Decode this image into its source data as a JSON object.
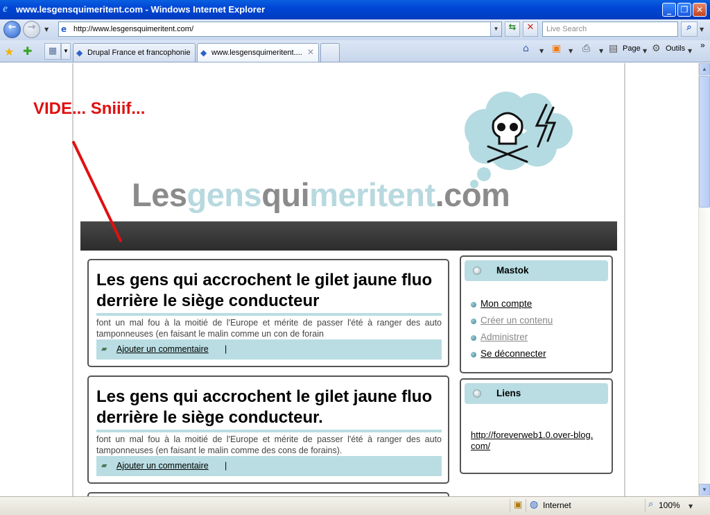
{
  "window": {
    "title": "www.lesgensquimeritent.com - Windows Internet Explorer",
    "minimize": "_",
    "maximize": "❐",
    "close": "✕"
  },
  "nav": {
    "back_icon": "back-arrow-icon",
    "forward_icon": "forward-arrow-icon",
    "address_url": "http://www.lesgensquimeritent.com/",
    "search_placeholder": "Live Search"
  },
  "tabs": [
    {
      "label": "Drupal France et francophonie",
      "active": false
    },
    {
      "label": "www.lesgensquimeritent....",
      "active": true
    }
  ],
  "commandbar": {
    "page_label": "Page",
    "tools_label": "Outils"
  },
  "page": {
    "annotation": "VIDE... Sniiif...",
    "logo": {
      "part1": "Les",
      "part2": "gens",
      "part3": "qui",
      "part4": "meritent",
      "part5": ".com"
    },
    "nodes": [
      {
        "title": "Les gens qui accrochent le gilet jaune fluo derrière le siège conducteur",
        "body": "font un mal fou à la moitié de l'Europe et mérite de passer l'été à ranger des auto tamponneuses (en faisant le malin comme un con de forain",
        "comment_link": "Ajouter un commentaire",
        "separator": "|"
      },
      {
        "title": "Les gens qui accrochent le gilet jaune fluo derrière le siège conducteur.",
        "body": "font un mal fou à la moitié de l'Europe et mérite de passer l'été à ranger des auto tamponneuses (en faisant le malin comme des cons de forains).",
        "comment_link": "Ajouter un commentaire",
        "separator": "|"
      }
    ],
    "sidebar": {
      "user_block": {
        "title": "Mastok",
        "items": [
          {
            "label": "Mon compte",
            "color": "#000000"
          },
          {
            "label": "Créer un contenu",
            "color": "#888888"
          },
          {
            "label": "Administrer",
            "color": "#888888"
          },
          {
            "label": "Se déconnecter",
            "color": "#000000"
          }
        ]
      },
      "links_block": {
        "title": "Liens",
        "link": "http://foreverweb1.0.over-blog.com/"
      }
    }
  },
  "status": {
    "zone": "Internet",
    "zoom": "100%"
  },
  "colors": {
    "accent_light_blue": "#b9dde2",
    "annotation_red": "#e01010",
    "dark_bar": "#333333",
    "xp_blue": "#0046d5"
  }
}
